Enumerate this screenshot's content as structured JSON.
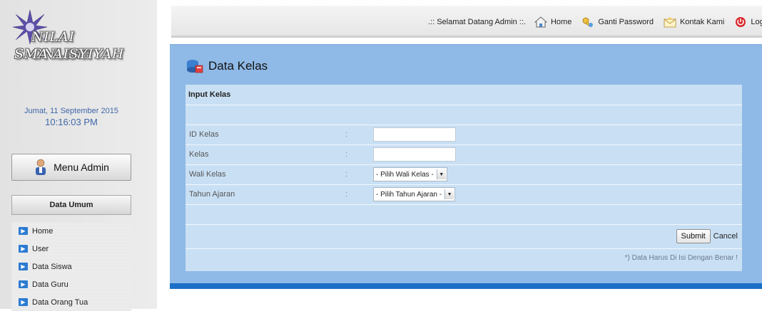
{
  "header": {
    "welcome": ".:: Selamat Datang Admin ::.",
    "nav": [
      {
        "label": "Home",
        "icon": "home-icon"
      },
      {
        "label": "Ganti Password",
        "icon": "key-icon"
      },
      {
        "label": "Kontak Kami",
        "icon": "envelope-icon"
      },
      {
        "label": "Logout",
        "icon": "power-icon"
      }
    ]
  },
  "sidebar": {
    "logo_line1": "NILAI ONLINE",
    "logo_line2": "SMA AISYIYAH",
    "date": "Jumat, 11 September 2015",
    "time": "10:16:03 PM",
    "menu_button": "Menu Admin",
    "section_title": "Data Umum",
    "items": [
      {
        "label": "Home"
      },
      {
        "label": "User"
      },
      {
        "label": "Data Siswa"
      },
      {
        "label": "Data Guru"
      },
      {
        "label": "Data Orang Tua"
      }
    ]
  },
  "main": {
    "title": "Data Kelas",
    "form": {
      "heading": "Input Kelas",
      "fields": {
        "id_kelas": {
          "label": "ID Kelas",
          "colon": ":",
          "value": ""
        },
        "kelas": {
          "label": "Kelas",
          "colon": ":",
          "value": ""
        },
        "wali_kelas": {
          "label": "Wali Kelas",
          "colon": ":",
          "selected": "- Pilih Wali Kelas -"
        },
        "tahun_ajaran": {
          "label": "Tahun Ajaran",
          "colon": ":",
          "selected": "- Pilih Tahun Ajaran -"
        }
      },
      "submit_label": "Submit",
      "cancel_label": "Cancel",
      "note": "*) Data Harus Di Isi Dengan Benar !"
    }
  },
  "colors": {
    "panel": "#8fb9e6",
    "form_bg": "#c9e0f4",
    "accent_bar": "#1c6fc7",
    "date_text": "#3f67a8"
  }
}
